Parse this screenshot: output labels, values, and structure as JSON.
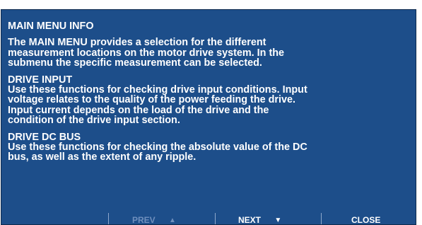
{
  "help": {
    "title": "MAIN MENU INFO",
    "intro": "The MAIN MENU provides a selection for the different measurement locations on the motor drive system. In the submenu the specific measurement can be selected.",
    "sections": [
      {
        "heading": "DRIVE INPUT",
        "body": "Use these functions for checking drive input conditions. Input voltage relates to the quality of the power feeding the drive. Input current depends on the load of the drive and the condition of the drive input section."
      },
      {
        "heading": "DRIVE DC BUS",
        "body": "Use these functions for checking the absolute value of the DC bus, as well as the extent of any ripple."
      }
    ]
  },
  "footer": {
    "prev_label": "PREV",
    "prev_arrow": "▲",
    "next_label": "NEXT",
    "next_arrow": "▼",
    "close_label": "CLOSE"
  },
  "colors": {
    "screen_background": "#1d4e8a",
    "text": "#ffffff",
    "disabled_text": "#6f8fbd"
  }
}
